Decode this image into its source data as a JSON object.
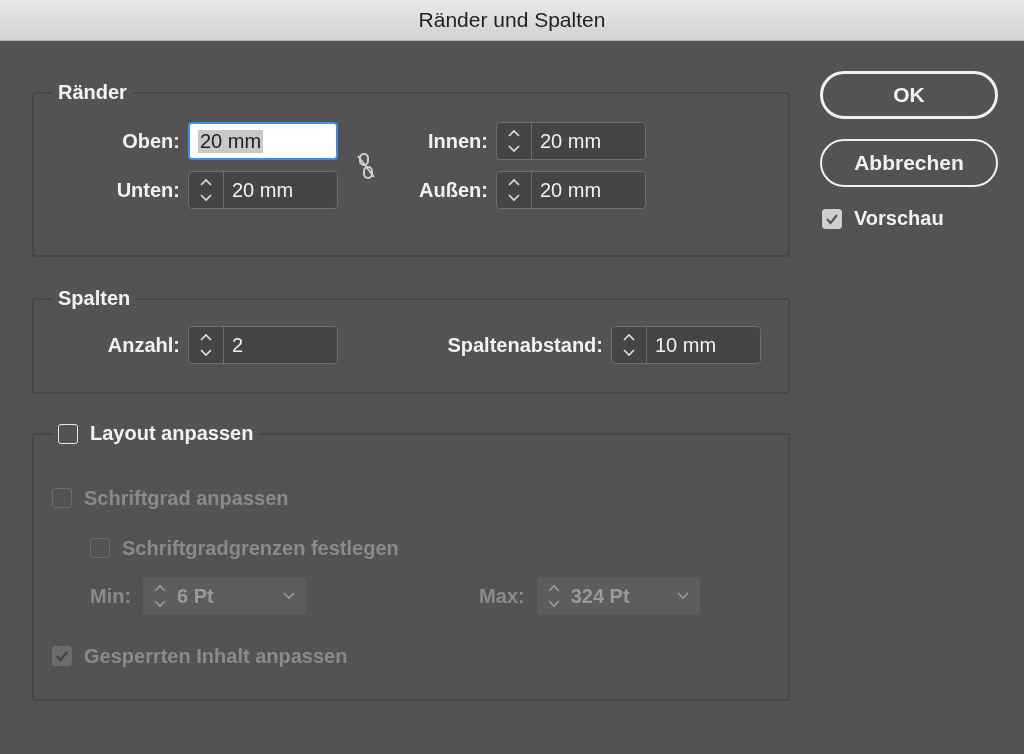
{
  "window": {
    "title": "Ränder und Spalten"
  },
  "margins": {
    "title": "Ränder",
    "fields": [
      {
        "label": "Oben:",
        "value": "20 mm",
        "focused": true
      },
      {
        "label": "Innen:",
        "value": "20 mm",
        "focused": false
      },
      {
        "label": "Unten:",
        "value": "20 mm",
        "focused": false
      },
      {
        "label": "Außen:",
        "value": "20 mm",
        "focused": false
      }
    ]
  },
  "columns": {
    "title": "Spalten",
    "fields": [
      {
        "label": "Anzahl:",
        "value": "2",
        "focused": false
      },
      {
        "label": "Spaltenabstand:",
        "value": "10 mm",
        "focused": false
      }
    ]
  },
  "layout": {
    "label": "Layout anpassen",
    "checked": false,
    "items": [
      {
        "kind": "checkbox",
        "label": "Schriftgrad anpassen",
        "checked": false,
        "disabled": true,
        "children": [
          {
            "kind": "checkbox",
            "label": "Schriftgradgrenzen festlegen",
            "checked": false,
            "disabled": true
          }
        ]
      },
      {
        "kind": "limits",
        "disabled": true,
        "fields": [
          {
            "label": "Min:",
            "value": "6 Pt"
          },
          {
            "label": "Max:",
            "value": "324 Pt"
          }
        ]
      },
      {
        "kind": "checkbox",
        "label": "Gesperrten Inhalt anpassen",
        "checked": true,
        "disabled": true
      }
    ]
  },
  "buttons": [
    {
      "label": "OK",
      "default": true
    },
    {
      "label": "Abbrechen",
      "default": false
    }
  ],
  "preview": {
    "label": "Vorschau",
    "checked": true
  }
}
